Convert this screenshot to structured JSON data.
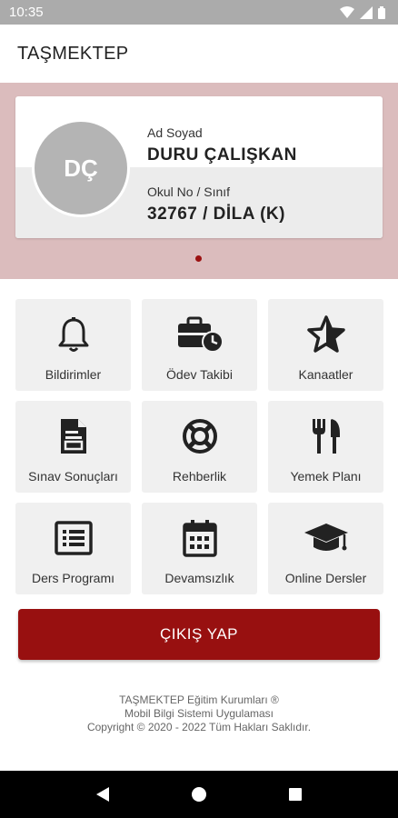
{
  "status_bar": {
    "time": "10:35"
  },
  "app_bar": {
    "title": "TAŞMEKTEP"
  },
  "profile": {
    "avatar_initials": "DÇ",
    "name_label": "Ad Soyad",
    "name_value": "DURU ÇALIŞKAN",
    "school_label": "Okul No / Sınıf",
    "school_value": "32767 / DİLA  (K)"
  },
  "menu": {
    "items": [
      {
        "label": "Bildirimler",
        "icon": "bell-icon"
      },
      {
        "label": "Ödev Takibi",
        "icon": "briefcase-clock-icon"
      },
      {
        "label": "Kanaatler",
        "icon": "star-icon"
      },
      {
        "label": "Sınav Sonuçları",
        "icon": "document-icon"
      },
      {
        "label": "Rehberlik",
        "icon": "lifebuoy-icon"
      },
      {
        "label": "Yemek Planı",
        "icon": "cutlery-icon"
      },
      {
        "label": "Ders Programı",
        "icon": "list-icon"
      },
      {
        "label": "Devamsızlık",
        "icon": "calendar-icon"
      },
      {
        "label": "Online Dersler",
        "icon": "graduation-cap-icon"
      }
    ]
  },
  "logout": {
    "label": "ÇIKIŞ YAP"
  },
  "footer": {
    "line1": "TAŞMEKTEP Eğitim Kurumları ®",
    "line2": "Mobil Bilgi Sistemi Uygulaması",
    "line3": "Copyright © 2020 - 2022 Tüm Hakları Saklıdır."
  },
  "colors": {
    "accent": "#981010",
    "hero_bg": "#dbbcbd",
    "tile_bg": "#f0f0f0"
  }
}
